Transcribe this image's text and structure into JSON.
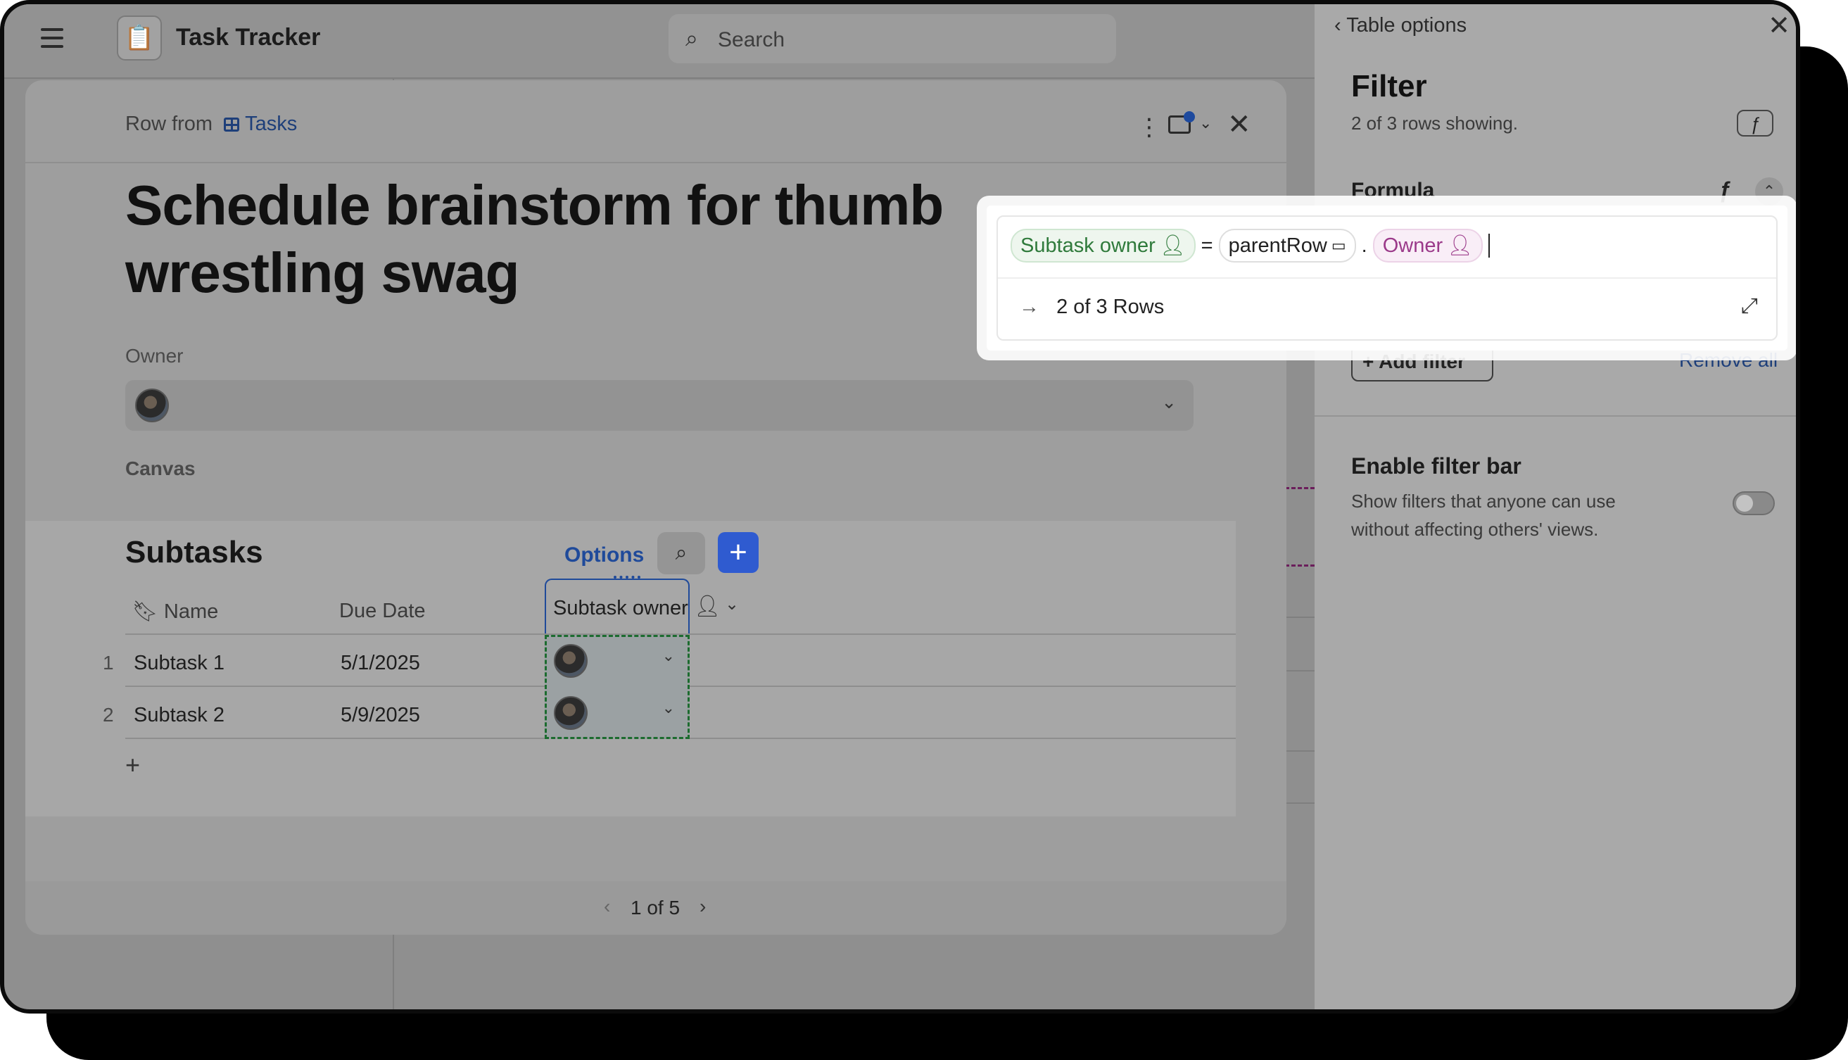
{
  "app": {
    "title": "Task Tracker",
    "search_placeholder": "Search",
    "app_icon": "clipboard-icon"
  },
  "modal": {
    "row_from_label": "Row from",
    "table_name": "Tasks",
    "title": "Schedule brainstorm for thumb wrestling swag",
    "owner_label": "Owner",
    "canvas_label": "Canvas",
    "pager": {
      "text": "1 of 5",
      "prev": "‹",
      "next": "›"
    }
  },
  "subtasks": {
    "title": "Subtasks",
    "options_label": "Options",
    "columns": [
      "Name",
      "Due Date",
      "Subtask owner"
    ],
    "rows": [
      {
        "num": "1",
        "name": "Subtask 1",
        "due": "5/1/2025"
      },
      {
        "num": "2",
        "name": "Subtask 2",
        "due": "5/9/2025"
      }
    ],
    "add_row": "+"
  },
  "panel": {
    "back_label": "Table options",
    "title": "Filter",
    "subtitle": "2 of 3 rows showing.",
    "formula_label": "Formula",
    "add_filter_label": "Add filter",
    "remove_all_label": "Remove all",
    "filter_bar_title": "Enable filter bar",
    "filter_bar_desc": "Show filters that anyone can use without affecting others' views.",
    "filter_bar_enabled": false
  },
  "formula_popup": {
    "tokens": {
      "left": "Subtask owner",
      "eq": "=",
      "ref": "parentRow",
      "dot": ".",
      "prop": "Owner"
    },
    "result": "2 of 3 Rows"
  },
  "colors": {
    "accent": "#2f5bd0",
    "link": "#1e3f7a",
    "chip_green": "#2f7a3b",
    "chip_pink": "#9b3a8a"
  }
}
